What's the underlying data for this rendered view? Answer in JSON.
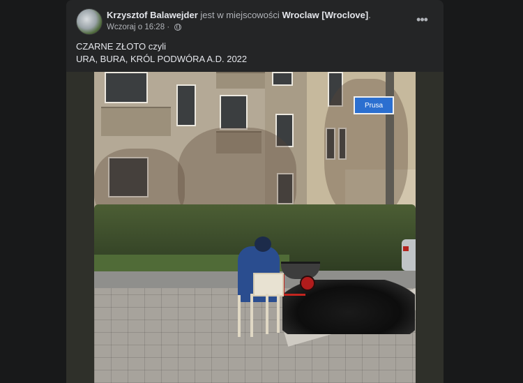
{
  "post": {
    "author_name": "Krzysztof Balawejder",
    "location_prefix": "jest w miejscowości",
    "location_name": "Wroclaw [Wroclove]",
    "location_suffix": ".",
    "timestamp": "Wczoraj o 16:28",
    "timestamp_separator": "·",
    "more_label": "•••",
    "text_lines": [
      "CZARNE ZŁOTO czyli",
      "URA, BURA, KRÓL PODWÓRA A.D. 2022"
    ]
  },
  "photo": {
    "street_sign_text": "Prusa"
  },
  "icons": {
    "privacy": "globe-icon",
    "more": "more-options-icon",
    "avatar": "profile-avatar"
  },
  "colors": {
    "background": "#18191a",
    "card": "#242526",
    "primary_text": "#e4e6eb",
    "secondary_text": "#b0b3b8"
  }
}
